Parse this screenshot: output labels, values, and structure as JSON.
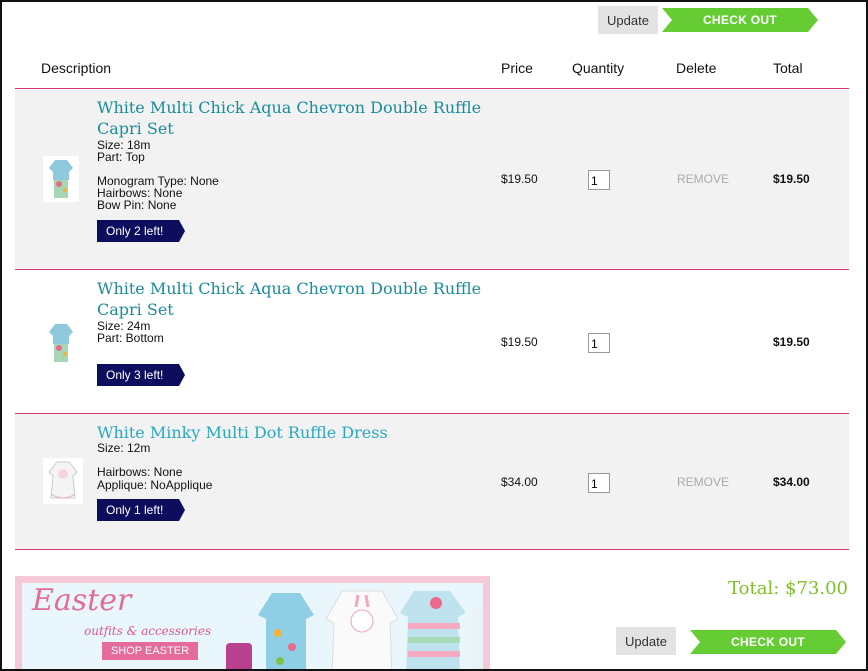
{
  "top_actions": {
    "update_label": "Update",
    "checkout_label": "CHECK OUT"
  },
  "table": {
    "headers": {
      "description": "Description",
      "price": "Price",
      "quantity": "Quantity",
      "delete": "Delete",
      "total": "Total"
    },
    "items": [
      {
        "title": "White Multi Chick Aqua Chevron Double Ruffle Capri Set",
        "size": "Size: 18m",
        "part": "Part: Top",
        "monogram": "Monogram Type: None",
        "hairbows": "Hairbows: None",
        "bowpin": "Bow Pin: None",
        "stock": "Only 2 left!",
        "price": "$19.50",
        "qty": "1",
        "remove": "REMOVE",
        "total": "$19.50"
      },
      {
        "title": "White Multi Chick Aqua Chevron Double Ruffle Capri Set",
        "size": "Size: 24m",
        "part": "Part: Bottom",
        "stock": "Only 3 left!",
        "price": "$19.50",
        "qty": "1",
        "total": "$19.50"
      },
      {
        "title": "White Minky Multi Dot Ruffle Dress",
        "size": "Size: 12m",
        "hairbows": "Hairbows: None",
        "applique": "Applique: NoApplique",
        "stock": "Only 1 left!",
        "price": "$34.00",
        "qty": "1",
        "remove": "REMOVE",
        "total": "$34.00"
      }
    ]
  },
  "summary": {
    "grand_total": "Total: $73.00"
  },
  "bottom_actions": {
    "update_label": "Update",
    "checkout_label": "CHECK OUT"
  },
  "banner": {
    "title": "Easter",
    "subtitle": "outfits & accessories",
    "button": "SHOP EASTER"
  },
  "colors": {
    "accent_green": "#66cc33",
    "badge_navy": "#0d0d5e",
    "title_teal": "#1a8c9a",
    "divider_pink": "#d6347a"
  }
}
